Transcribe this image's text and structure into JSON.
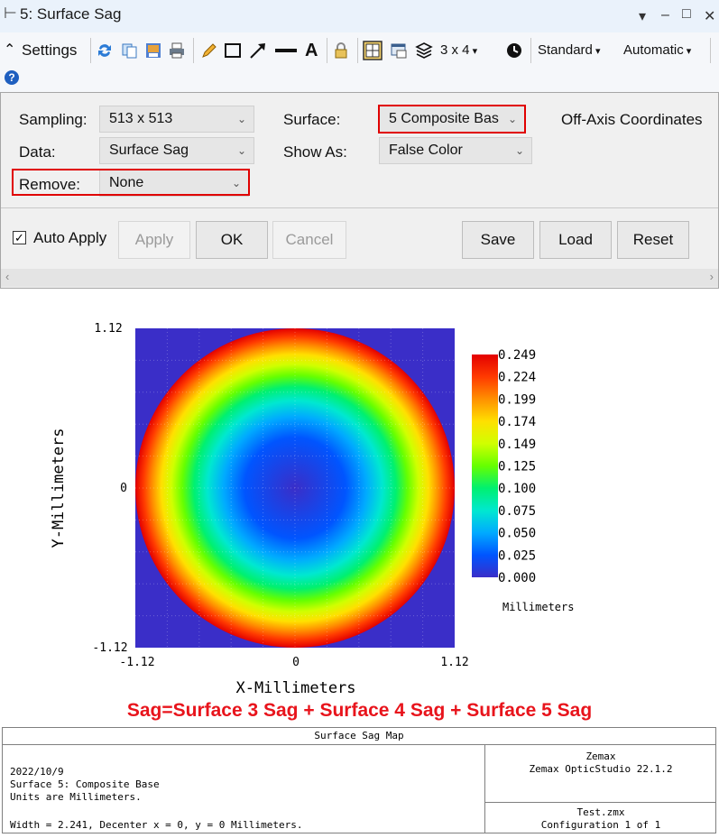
{
  "window": {
    "title": "5: Surface Sag"
  },
  "toolbar": {
    "settings_label": "Settings",
    "layout_label": "3 x 4",
    "standard_label": "Standard",
    "automatic_label": "Automatic",
    "icons": [
      "collapse-icon",
      "refresh-icon",
      "copy-icon",
      "save-image-icon",
      "print-icon",
      "pencil-icon",
      "rectangle-icon",
      "arrow-icon",
      "line-icon",
      "text-icon",
      "lock-icon",
      "grid-icon",
      "window-icon",
      "layers-icon",
      "clock-icon",
      "help-icon"
    ]
  },
  "settings": {
    "sampling_label": "Sampling:",
    "sampling_value": "513 x 513",
    "data_label": "Data:",
    "data_value": "Surface Sag",
    "remove_label": "Remove:",
    "remove_value": "None",
    "surface_label": "Surface:",
    "surface_value": "5 Composite Bas",
    "show_as_label": "Show As:",
    "show_as_value": "False Color",
    "off_axis_label": "Off-Axis Coordinates",
    "auto_apply_label": "Auto Apply",
    "auto_apply_checked": true,
    "apply_label": "Apply",
    "ok_label": "OK",
    "cancel_label": "Cancel",
    "save_label": "Save",
    "load_label": "Load",
    "reset_label": "Reset"
  },
  "chart_data": {
    "type": "heatmap",
    "xlabel": "X-Millimeters",
    "ylabel": "Y-Millimeters",
    "xlim": [
      -1.12,
      1.12
    ],
    "ylim": [
      -1.12,
      1.12
    ],
    "x_ticks": [
      "-1.12",
      "0",
      "1.12"
    ],
    "y_ticks": [
      "1.12",
      "0",
      "-1.12"
    ],
    "colorbar_ticks": [
      "0.249",
      "0.224",
      "0.199",
      "0.174",
      "0.149",
      "0.125",
      "0.100",
      "0.075",
      "0.050",
      "0.025",
      "0.000"
    ],
    "colorbar_unit": "Millimeters",
    "value_range": [
      0.0,
      0.249
    ],
    "aperture_radius": 1.12,
    "outside_value": 0.0,
    "colormap": [
      "#3a2ec8",
      "#0055ff",
      "#00aaff",
      "#00e8d0",
      "#00f070",
      "#66ff00",
      "#d0ff00",
      "#ffe000",
      "#ff9000",
      "#ff3a00",
      "#e30000"
    ]
  },
  "annotation": "Sag=Surface 3 Sag + Surface 4 Sag + Surface 5 Sag",
  "footer": {
    "title": "Surface Sag Map",
    "left_lines": [
      "2022/10/9",
      "Surface 5: Composite Base",
      "Units are Millimeters."
    ],
    "width_line": "Width = 2.241, Decenter x = 0, y = 0 Millimeters.",
    "right_top": [
      "Zemax",
      "Zemax OpticStudio 22.1.2"
    ],
    "right_bottom": [
      "Test.zmx",
      "Configuration 1 of 1"
    ]
  }
}
